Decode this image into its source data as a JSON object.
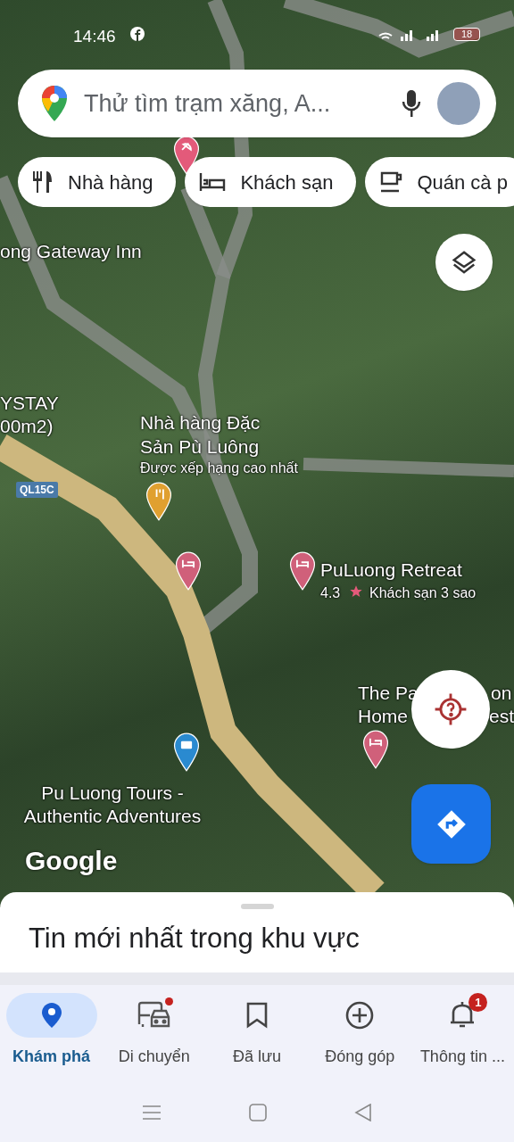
{
  "status_bar": {
    "time": "14:46",
    "battery": "18"
  },
  "search": {
    "placeholder": "Thử tìm trạm xăng, A..."
  },
  "chips": [
    {
      "label": "Nhà hàng",
      "kind": "restaurant"
    },
    {
      "label": "Khách sạn",
      "kind": "hotel"
    },
    {
      "label": "Quán cà p",
      "kind": "cafe"
    }
  ],
  "map": {
    "labels": [
      {
        "text": "ong Gateway Inn",
        "kind": "place"
      },
      {
        "text": "YSTAY",
        "kind": "place"
      },
      {
        "text": "00m2)",
        "kind": "place"
      },
      {
        "text": "Nhà hàng Đặc Sản Pù Luông",
        "kind": "place"
      },
      {
        "text": "Được xếp hạng cao nhất",
        "kind": "note"
      },
      {
        "text": "PuLuong Retreat",
        "kind": "place"
      },
      {
        "text": "4.3",
        "kind": "note"
      },
      {
        "text": "Khách sạn 3 sao",
        "kind": "note"
      },
      {
        "text": "The Pa",
        "kind": "place"
      },
      {
        "text": "on",
        "kind": "place"
      },
      {
        "text": "Home",
        "kind": "place"
      },
      {
        "text": "est",
        "kind": "place"
      },
      {
        "text": "Pu Luong Tours - Authentic Adventures",
        "kind": "place"
      }
    ],
    "road_shield": "QL15C",
    "pins": [
      {
        "kind": "attraction"
      },
      {
        "kind": "restaurant"
      },
      {
        "kind": "hotel"
      },
      {
        "kind": "hotel"
      },
      {
        "kind": "hotel"
      },
      {
        "kind": "photo"
      }
    ],
    "logo": "Google"
  },
  "sheet": {
    "title": "Tin mới nhất trong khu vực"
  },
  "nav": [
    {
      "label": "Khám phá",
      "kind": "explore",
      "selected": true,
      "dot": false
    },
    {
      "label": "Di chuyển",
      "kind": "commute",
      "selected": false,
      "dot": true
    },
    {
      "label": "Đã lưu",
      "kind": "saved",
      "selected": false,
      "dot": false
    },
    {
      "label": "Đóng góp",
      "kind": "contribute",
      "selected": false,
      "dot": false
    },
    {
      "label": "Thông tin ...",
      "kind": "updates",
      "selected": false,
      "dot": false,
      "count": "1"
    }
  ]
}
